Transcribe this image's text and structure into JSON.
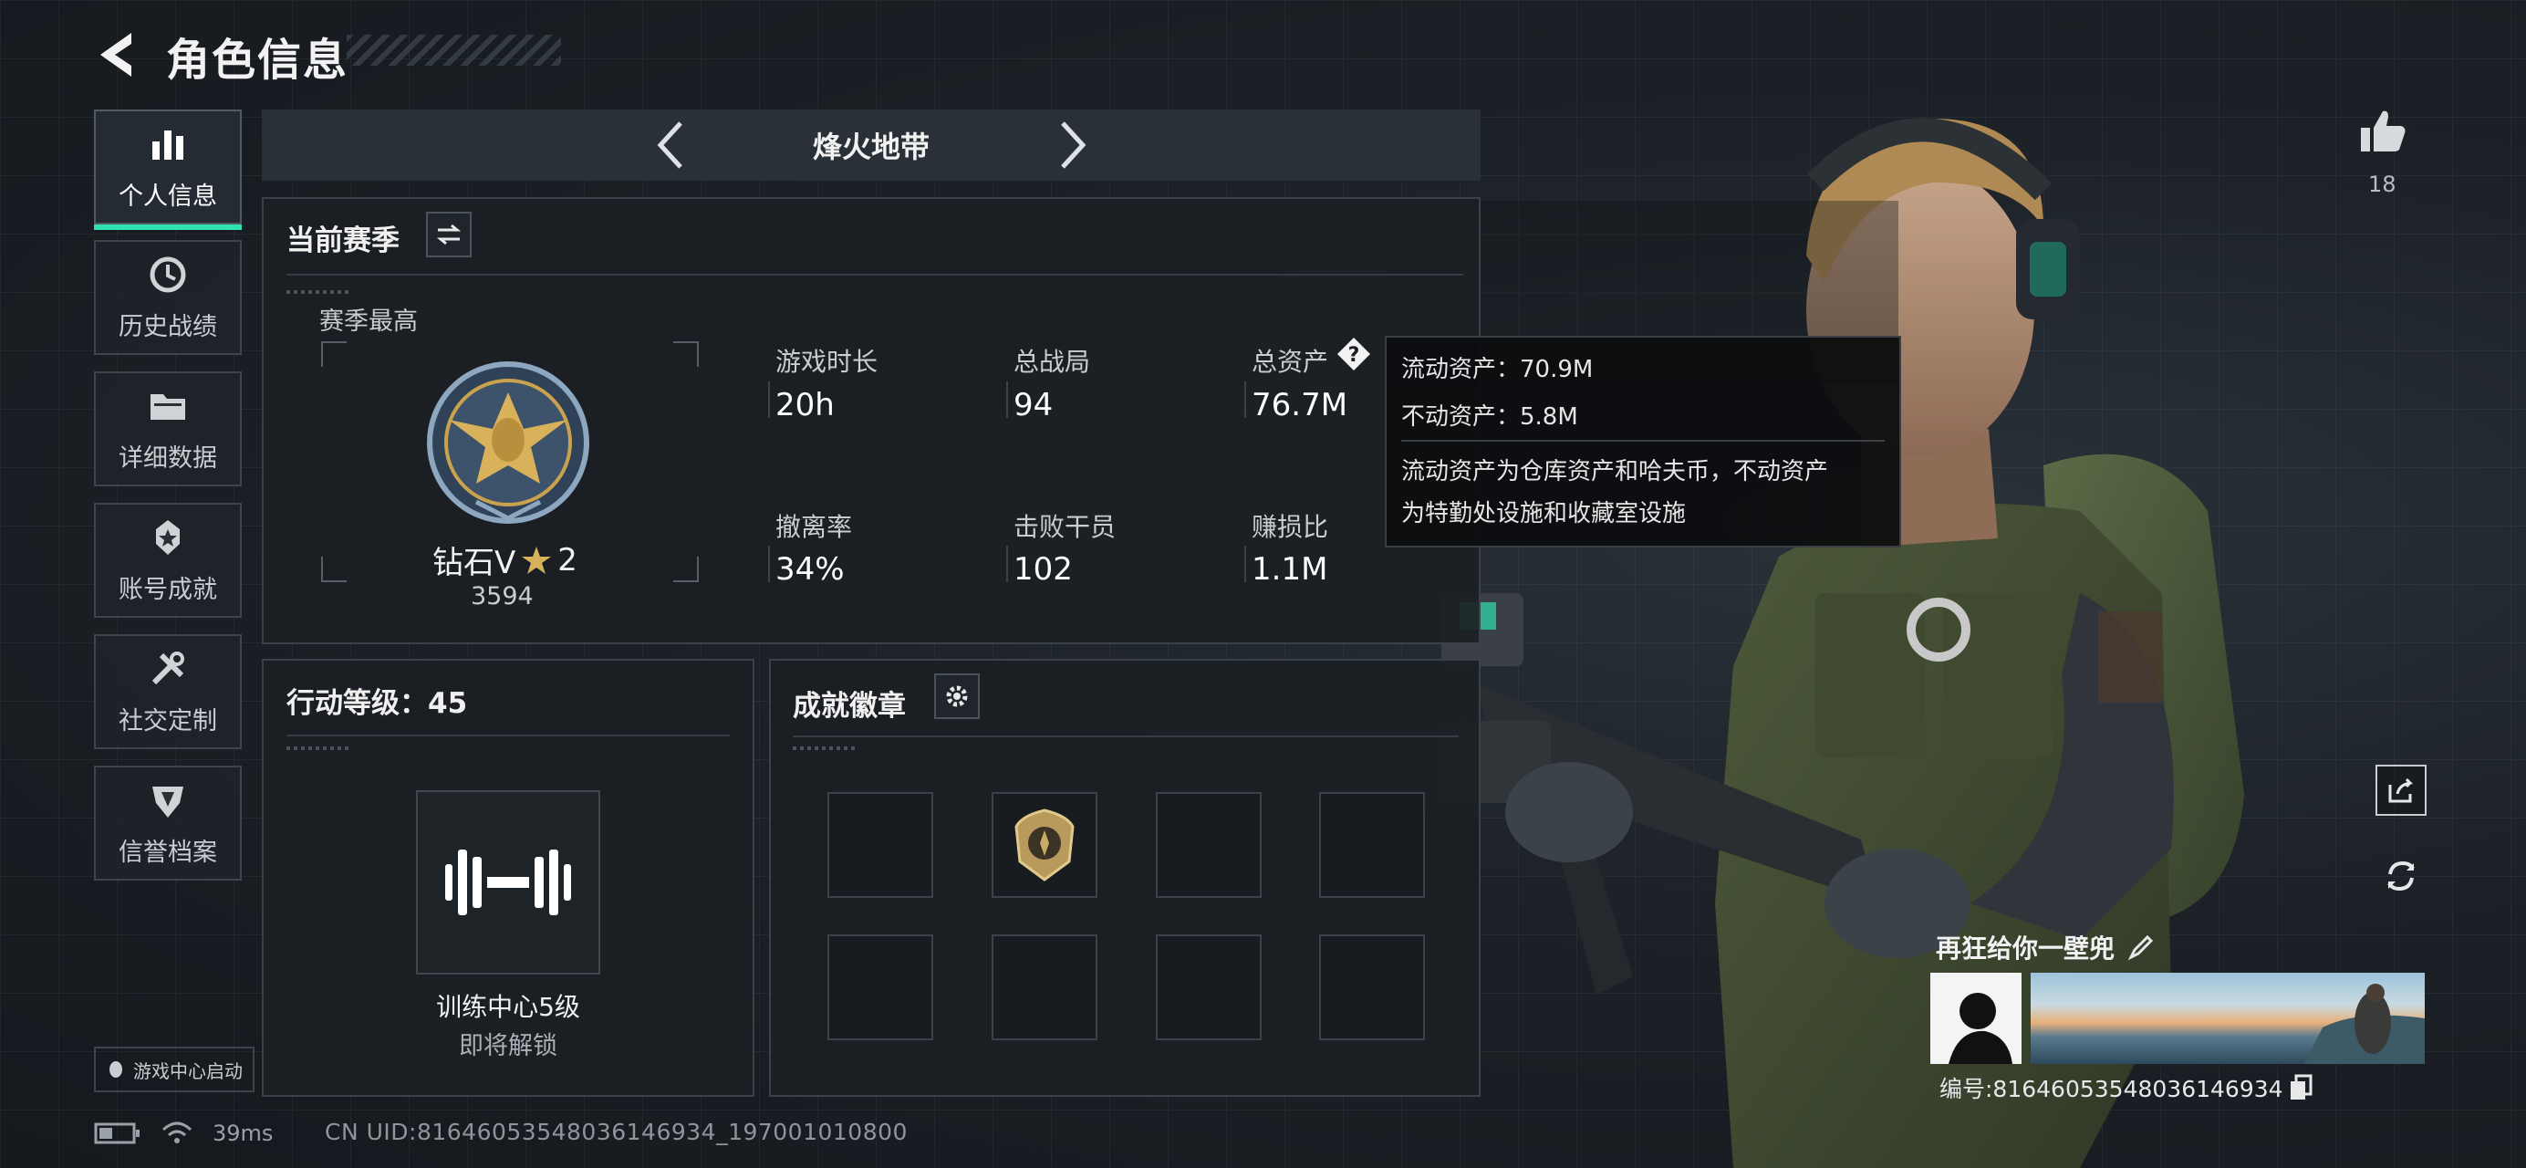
{
  "header": {
    "title": "角色信息"
  },
  "sidebar": {
    "items": [
      {
        "label": "个人信息",
        "icon": "bar-chart-icon",
        "active": true
      },
      {
        "label": "历史战绩",
        "icon": "history-clock-icon"
      },
      {
        "label": "详细数据",
        "icon": "folder-icon"
      },
      {
        "label": "账号成就",
        "icon": "medal-icon"
      },
      {
        "label": "社交定制",
        "icon": "tools-icon"
      },
      {
        "label": "信誉档案",
        "icon": "shield-emblem-icon"
      }
    ],
    "game_center": "游戏中心启动"
  },
  "mode": {
    "title": "烽火地带"
  },
  "season": {
    "heading": "当前赛季",
    "best_label": "赛季最高",
    "rank_name": "钻石V",
    "rank_stars": "2",
    "rank_score": "3594",
    "stats": [
      {
        "label": "游戏时长",
        "value": "20h"
      },
      {
        "label": "总战局",
        "value": "94"
      },
      {
        "label": "总资产",
        "value": "76.7M"
      },
      {
        "label": "撤离率",
        "value": "34%"
      },
      {
        "label": "击败干员",
        "value": "102"
      },
      {
        "label": "赚损比",
        "value": "1.1M"
      }
    ]
  },
  "tooltip": {
    "line1": "流动资产：70.9M",
    "line2": "不动资产：5.8M",
    "desc1": "流动资产为仓库资产和哈夫币，不动资产",
    "desc2": "为特勤处设施和收藏室设施"
  },
  "action_level": {
    "heading": "行动等级：45",
    "item_name": "训练中心5级",
    "item_status": "即将解锁"
  },
  "badges": {
    "heading": "成就徽章",
    "slots": 8,
    "filled_index": 1
  },
  "profile": {
    "likes": "18",
    "player_name": "再狂给你一壁兜",
    "player_id": "编号:81646053548036146934"
  },
  "status_bar": {
    "ping": "39ms",
    "uid": "CN UID:81646053548036146934_197001010800"
  },
  "colors": {
    "accent": "#2fe0b0",
    "panel_border": "#3a4148",
    "background": "#1a1e24"
  }
}
